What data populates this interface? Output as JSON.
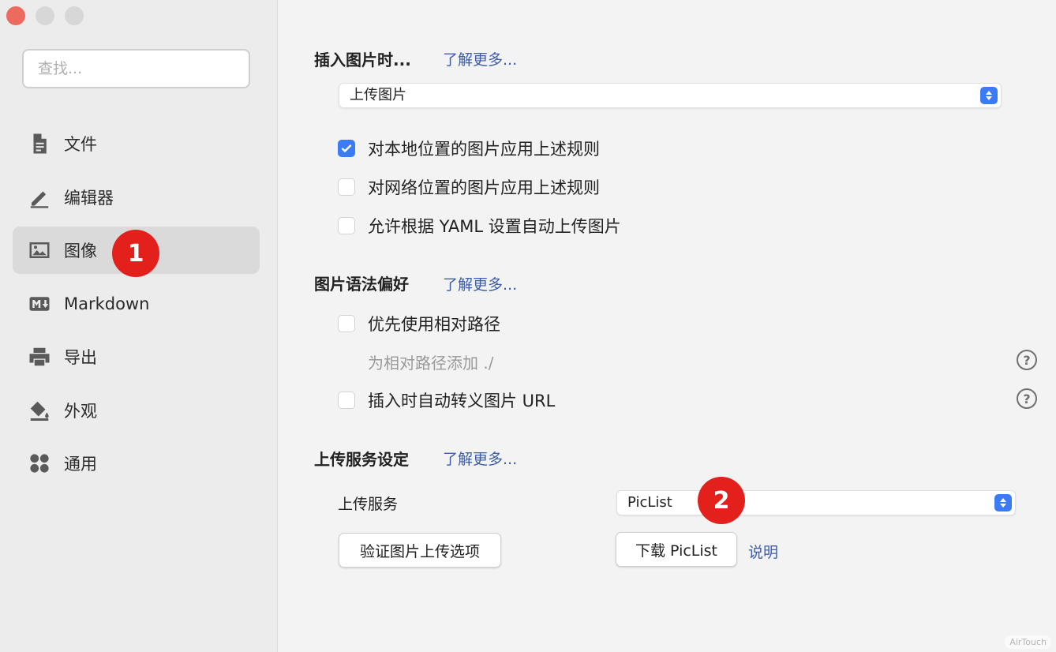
{
  "sidebar": {
    "search_placeholder": "查找...",
    "items": [
      {
        "label": "文件",
        "icon": "file-icon"
      },
      {
        "label": "编辑器",
        "icon": "pencil-icon"
      },
      {
        "label": "图像",
        "icon": "image-icon",
        "active": true
      },
      {
        "label": "Markdown",
        "icon": "markdown-icon"
      },
      {
        "label": "导出",
        "icon": "printer-icon"
      },
      {
        "label": "外观",
        "icon": "paint-bucket-icon"
      },
      {
        "label": "通用",
        "icon": "grid-icon"
      }
    ]
  },
  "badges": {
    "one": "1",
    "two": "2"
  },
  "insert_image": {
    "title": "插入图片时...",
    "learn_more": "了解更多...",
    "select_value": "上传图片",
    "options": [
      {
        "label": "对本地位置的图片应用上述规则",
        "checked": true
      },
      {
        "label": "对网络位置的图片应用上述规则",
        "checked": false
      },
      {
        "label": "允许根据 YAML 设置自动上传图片",
        "checked": false
      }
    ]
  },
  "syntax": {
    "title": "图片语法偏好",
    "learn_more": "了解更多...",
    "relative_path": "优先使用相对路径",
    "add_dot_slash": "为相对路径添加 ./",
    "escape_url": "插入时自动转义图片 URL",
    "help": "?"
  },
  "upload": {
    "title": "上传服务设定",
    "learn_more": "了解更多...",
    "service_label": "上传服务",
    "service_value": "PicList",
    "verify_button": "验证图片上传选项",
    "download_button": "下载 PicList",
    "explain_link": "说明"
  },
  "watermark": "AirTouch",
  "colors": {
    "accent": "#3b7bf6",
    "badge": "#e4201d",
    "link": "#3d5da8"
  }
}
